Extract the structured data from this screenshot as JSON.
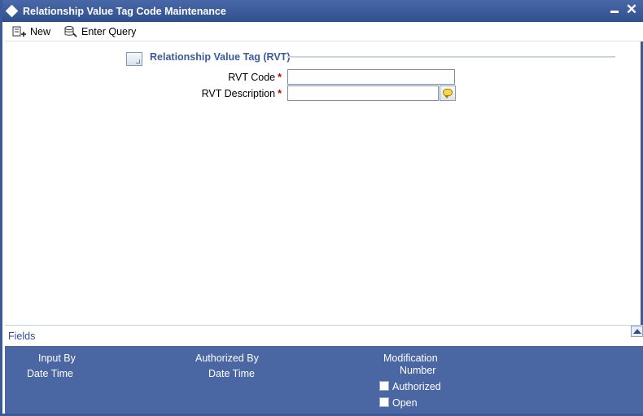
{
  "window": {
    "title": "Relationship Value Tag Code Maintenance",
    "minimize_icon": "minimize-icon",
    "close_glyph": "✕"
  },
  "toolbar": {
    "new_label": "New",
    "enter_query_label": "Enter Query"
  },
  "section": {
    "title": "Relationship Value Tag (RVT)"
  },
  "form": {
    "rvt_code_label": "RVT Code",
    "rvt_code_value": "",
    "rvt_description_label": "RVT Description",
    "rvt_description_value": "",
    "required_marker": "*"
  },
  "footer": {
    "fields_label": "Fields",
    "input_by_label": "Input By",
    "date_time_label_1": "Date Time",
    "authorized_by_label": "Authorized By",
    "date_time_label_2": "Date Time",
    "modification_label": "Modification",
    "number_label": "Number",
    "authorized_checkbox_label": "Authorized",
    "open_checkbox_label": "Open"
  },
  "colors": {
    "title_bar": "#3a5898",
    "footer_bg": "#4a67a3",
    "section_title": "#3d5b99",
    "required": "#c00000"
  }
}
